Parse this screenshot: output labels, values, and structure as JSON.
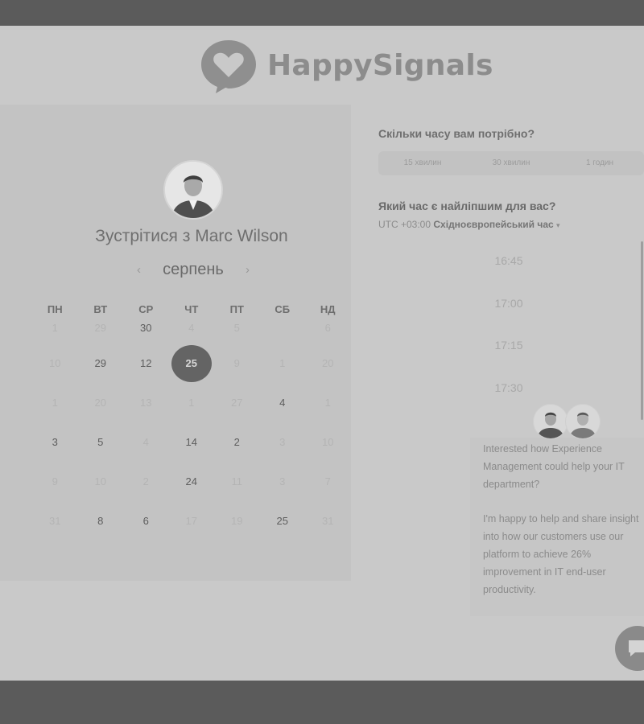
{
  "brand": {
    "name": "HappySignals"
  },
  "meeting": {
    "title": "Зустрітися з Marc Wilson"
  },
  "calendar": {
    "month": "серпень",
    "prev_label": "‹",
    "next_label": "›",
    "weekdays": [
      "ПН",
      "ВТ",
      "СР",
      "ЧТ",
      "ПТ",
      "СБ",
      "НД"
    ],
    "weeks": [
      [
        {
          "d": "1",
          "a": false
        },
        {
          "d": "29",
          "a": false
        },
        {
          "d": "30",
          "a": true
        },
        {
          "d": "4",
          "a": false
        },
        {
          "d": "5",
          "a": false
        },
        {
          "d": "",
          "a": false
        },
        {
          "d": "6",
          "a": false
        }
      ],
      [
        {
          "d": "10",
          "a": false
        },
        {
          "d": "29",
          "a": true
        },
        {
          "d": "12",
          "a": true
        },
        {
          "d": "25",
          "a": true,
          "s": true
        },
        {
          "d": "9",
          "a": false
        },
        {
          "d": "1",
          "a": false
        },
        {
          "d": "20",
          "a": false
        }
      ],
      [
        {
          "d": "1",
          "a": false
        },
        {
          "d": "20",
          "a": false
        },
        {
          "d": "13",
          "a": false
        },
        {
          "d": "1",
          "a": false
        },
        {
          "d": "27",
          "a": false
        },
        {
          "d": "4",
          "a": true
        },
        {
          "d": "1",
          "a": false
        }
      ],
      [
        {
          "d": "3",
          "a": true
        },
        {
          "d": "5",
          "a": true
        },
        {
          "d": "4",
          "a": false
        },
        {
          "d": "14",
          "a": true
        },
        {
          "d": "2",
          "a": true
        },
        {
          "d": "3",
          "a": false
        },
        {
          "d": "10",
          "a": false
        }
      ],
      [
        {
          "d": "9",
          "a": false
        },
        {
          "d": "10",
          "a": false
        },
        {
          "d": "2",
          "a": false
        },
        {
          "d": "24",
          "a": true
        },
        {
          "d": "11",
          "a": false
        },
        {
          "d": "3",
          "a": false
        },
        {
          "d": "7",
          "a": false
        }
      ],
      [
        {
          "d": "31",
          "a": false
        },
        {
          "d": "8",
          "a": true
        },
        {
          "d": "6",
          "a": true
        },
        {
          "d": "17",
          "a": false
        },
        {
          "d": "19",
          "a": false
        },
        {
          "d": "25",
          "a": true
        },
        {
          "d": "31",
          "a": false
        }
      ]
    ]
  },
  "duration": {
    "question": "Скільки часу вам потрібно?",
    "options": [
      "15 хвилин",
      "30 хвилин",
      "1 годин"
    ]
  },
  "time": {
    "question": "Який час є найліпшим для вас?",
    "tz_offset": "UTC +03:00",
    "tz_name": "Східноєвропейський час",
    "tz_caret": "▾",
    "slots": [
      "16:45",
      "17:00",
      "17:15",
      "17:30"
    ]
  },
  "chat": {
    "message_1": "Interested how Experience Management could help your IT department?",
    "message_2": "I'm happy to help and share insight into how our customers use our platform to achieve 26% improvement in IT end-user productivity."
  },
  "colors": {
    "accent": "#646464",
    "panel": "#c3c3c3",
    "brand": "#8c8c8c"
  }
}
